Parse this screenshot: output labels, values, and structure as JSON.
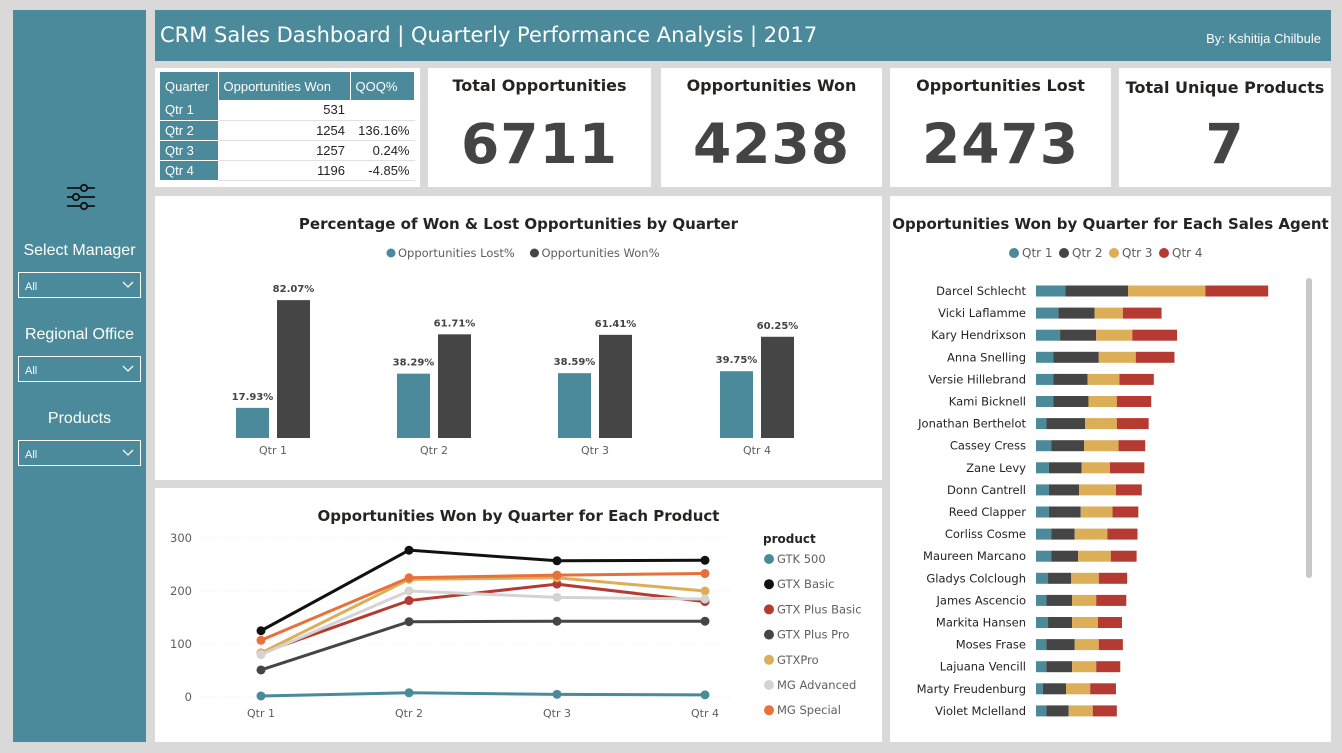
{
  "header": {
    "title": "CRM Sales Dashboard | Quarterly Performance Analysis | 2017",
    "author": "By: Kshitija Chilbule"
  },
  "sidebar": {
    "filter_icon": "sliders-icon",
    "slicers": [
      {
        "label": "Select Manager",
        "value": "All"
      },
      {
        "label": "Regional Office",
        "value": "All"
      },
      {
        "label": "Products",
        "value": "All"
      }
    ]
  },
  "quarter_table": {
    "headers": [
      "Quarter",
      "Opportunities Won",
      "QOQ%"
    ],
    "rows": [
      {
        "quarter": "Qtr 1",
        "won": "531",
        "qoq": ""
      },
      {
        "quarter": "Qtr 2",
        "won": "1254",
        "qoq": "136.16%"
      },
      {
        "quarter": "Qtr 3",
        "won": "1257",
        "qoq": "0.24%"
      },
      {
        "quarter": "Qtr 4",
        "won": "1196",
        "qoq": "-4.85%"
      }
    ]
  },
  "kpis": [
    {
      "title": "Total Opportunities",
      "value": "6711"
    },
    {
      "title": "Opportunities Won",
      "value": "4238"
    },
    {
      "title": "Opportunities Lost",
      "value": "2473"
    },
    {
      "title": "Total Unique Products",
      "value": "7"
    }
  ],
  "colors": {
    "teal": "#4a8a9a",
    "dark": "#454545",
    "gold": "#dcae57",
    "red": "#b53b32"
  },
  "chart_data": [
    {
      "type": "bar",
      "title": "Percentage of Won & Lost Opportunities by Quarter",
      "categories": [
        "Qtr 1",
        "Qtr 2",
        "Qtr 3",
        "Qtr 4"
      ],
      "series": [
        {
          "name": "Opportunities Lost%",
          "color": "#4a8a9a",
          "values": [
            17.93,
            38.29,
            38.59,
            39.75
          ],
          "labels": [
            "17.93%",
            "38.29%",
            "38.59%",
            "39.75%"
          ]
        },
        {
          "name": "Opportunities Won%",
          "color": "#454545",
          "values": [
            82.07,
            61.71,
            61.41,
            60.25
          ],
          "labels": [
            "82.07%",
            "61.71%",
            "61.41%",
            "60.25%"
          ]
        }
      ],
      "legend": "top-center",
      "ylim": [
        0,
        100
      ]
    },
    {
      "type": "line",
      "title": "Opportunities Won by Quarter for Each Product",
      "categories": [
        "Qtr 1",
        "Qtr 2",
        "Qtr 3",
        "Qtr 4"
      ],
      "yticks": [
        "0",
        "100",
        "200",
        "300"
      ],
      "ylim": [
        0,
        300
      ],
      "legend_title": "product",
      "legend": "right",
      "series": [
        {
          "name": "GTK 500",
          "color": "#4a8a9a",
          "values": [
            2,
            8,
            5,
            4
          ]
        },
        {
          "name": "GTX Basic",
          "color": "#111111",
          "values": [
            125,
            277,
            257,
            258
          ]
        },
        {
          "name": "GTX Plus Basic",
          "color": "#b53b32",
          "values": [
            83,
            182,
            213,
            180
          ]
        },
        {
          "name": "GTX Plus Pro",
          "color": "#454545",
          "values": [
            51,
            142,
            143,
            143
          ]
        },
        {
          "name": "GTXPro",
          "color": "#dcae57",
          "values": [
            83,
            222,
            225,
            200
          ]
        },
        {
          "name": "MG Advanced",
          "color": "#d4d4d4",
          "values": [
            80,
            200,
            188,
            185
          ]
        },
        {
          "name": "MG Special",
          "color": "#e8703a",
          "values": [
            107,
            225,
            230,
            233
          ]
        }
      ]
    },
    {
      "type": "bar",
      "orientation": "horizontal-stacked",
      "title": "Opportunities Won by Quarter for Each Sales Agent",
      "legend": "top-center",
      "series_names": [
        "Qtr 1",
        "Qtr 2",
        "Qtr 3",
        "Qtr 4"
      ],
      "series_colors": [
        "#4a8a9a",
        "#454545",
        "#dcae57",
        "#b53b32"
      ],
      "agents": [
        {
          "name": "Darcel Schlecht",
          "values": [
            34,
            73,
            90,
            73
          ]
        },
        {
          "name": "Vicki Laflamme",
          "values": [
            26,
            42,
            33,
            45
          ]
        },
        {
          "name": "Kary Hendrixson",
          "values": [
            28,
            42,
            42,
            52
          ]
        },
        {
          "name": "Anna Snelling",
          "values": [
            20,
            53,
            43,
            45
          ]
        },
        {
          "name": "Versie Hillebrand",
          "values": [
            20,
            40,
            37,
            40
          ]
        },
        {
          "name": "Kami Bicknell",
          "values": [
            20,
            41,
            33,
            40
          ]
        },
        {
          "name": "Jonathan Berthelot",
          "values": [
            12,
            45,
            37,
            37
          ]
        },
        {
          "name": "Cassey Cress",
          "values": [
            18,
            38,
            40,
            31
          ]
        },
        {
          "name": "Zane Levy",
          "values": [
            15,
            38,
            33,
            40
          ]
        },
        {
          "name": "Donn Cantrell",
          "values": [
            15,
            35,
            43,
            30
          ]
        },
        {
          "name": "Reed Clapper",
          "values": [
            15,
            37,
            37,
            30
          ]
        },
        {
          "name": "Corliss Cosme",
          "values": [
            18,
            27,
            38,
            35
          ]
        },
        {
          "name": "Maureen Marcano",
          "values": [
            18,
            31,
            38,
            30
          ]
        },
        {
          "name": "Gladys Colclough",
          "values": [
            14,
            27,
            32,
            33
          ]
        },
        {
          "name": "James Ascencio",
          "values": [
            12,
            30,
            28,
            35
          ]
        },
        {
          "name": "Markita Hansen",
          "values": [
            14,
            28,
            30,
            28
          ]
        },
        {
          "name": "Moses Frase",
          "values": [
            12,
            33,
            28,
            28
          ]
        },
        {
          "name": "Lajuana Vencill",
          "values": [
            12,
            30,
            28,
            28
          ]
        },
        {
          "name": "Marty Freudenburg",
          "values": [
            8,
            27,
            28,
            30
          ]
        },
        {
          "name": "Violet Mclelland",
          "values": [
            12,
            26,
            28,
            28
          ]
        }
      ]
    }
  ]
}
